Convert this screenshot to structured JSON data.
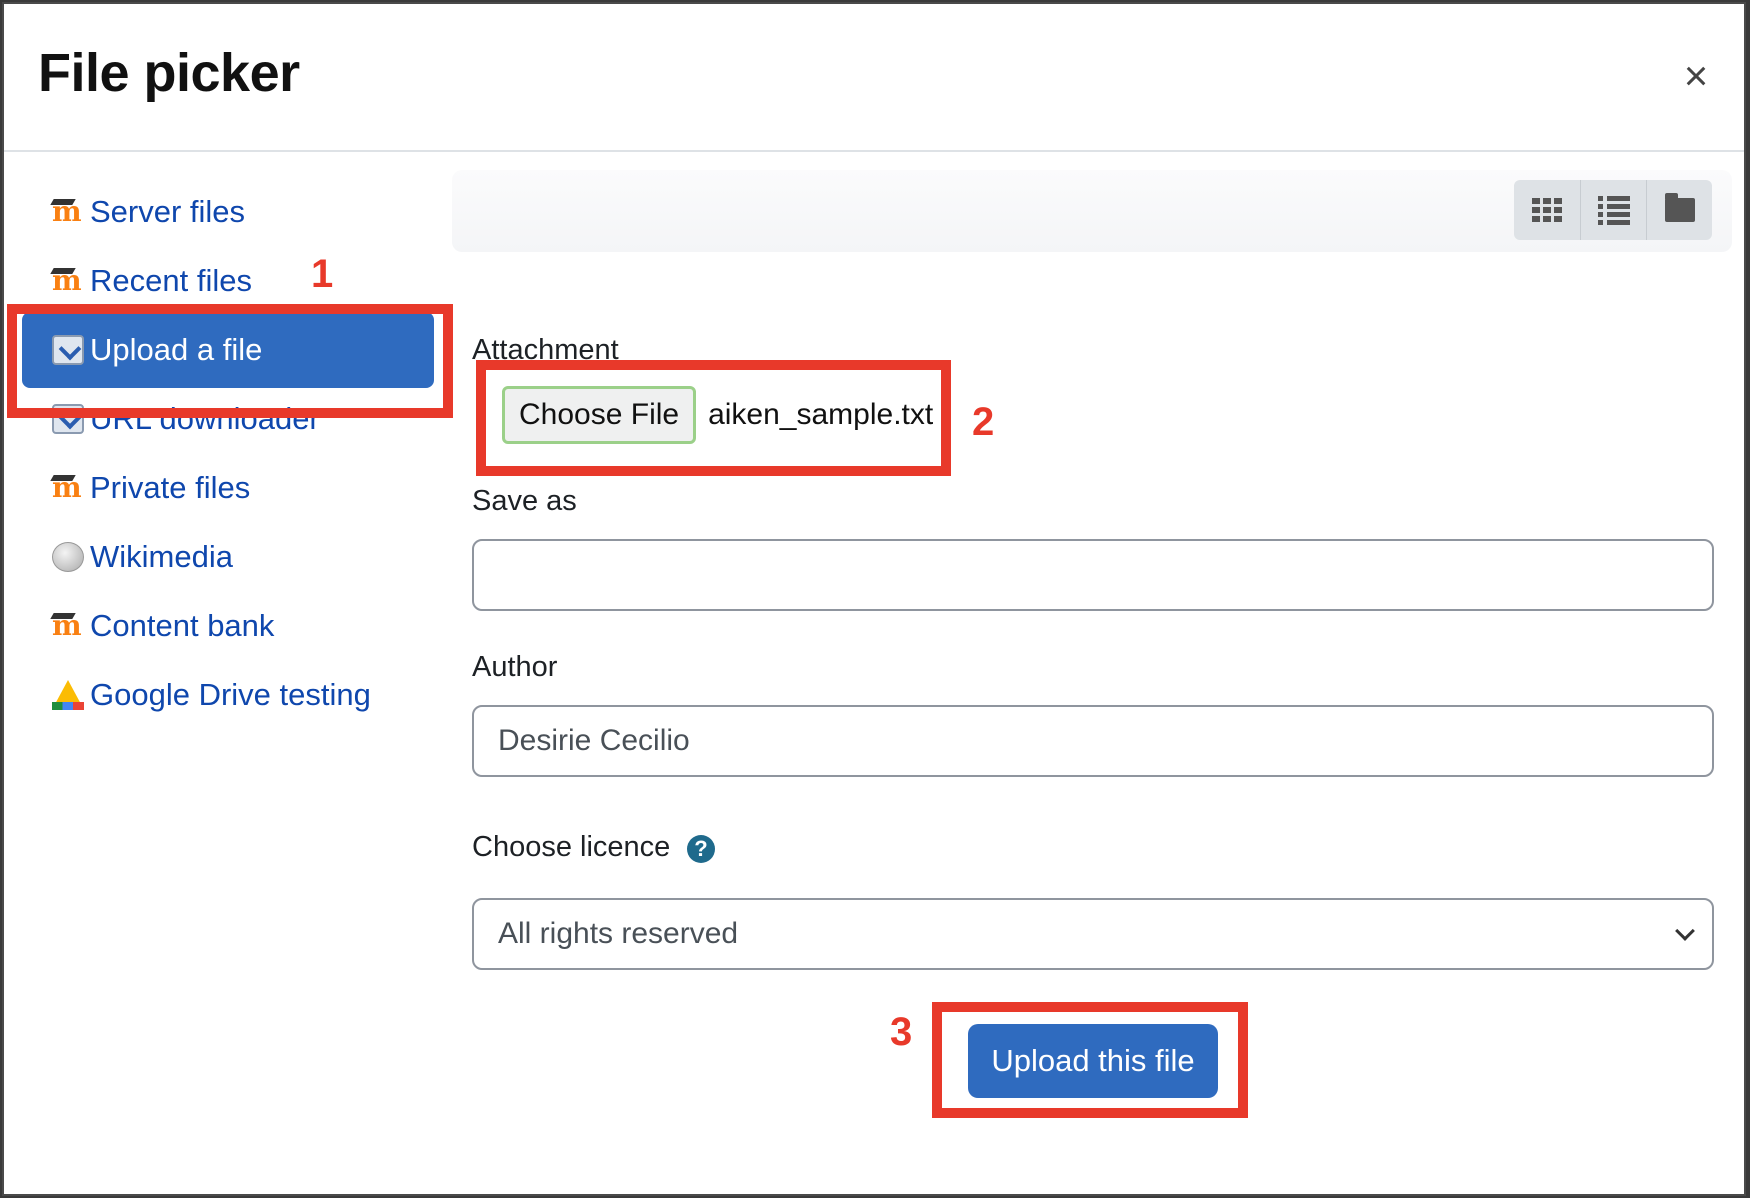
{
  "dialog": {
    "title": "File picker",
    "close_glyph": "×"
  },
  "sidebar": {
    "items": [
      {
        "label": "Server files",
        "icon": "moodle-icon"
      },
      {
        "label": "Recent files",
        "icon": "moodle-icon"
      },
      {
        "label": "Upload a file",
        "icon": "upload-icon",
        "active": true
      },
      {
        "label": "URL downloader",
        "icon": "upload-icon"
      },
      {
        "label": "Private files",
        "icon": "moodle-icon"
      },
      {
        "label": "Wikimedia",
        "icon": "globe-icon"
      },
      {
        "label": "Content bank",
        "icon": "moodle-icon"
      },
      {
        "label": "Google Drive testing",
        "icon": "google-drive-icon"
      }
    ]
  },
  "toolbar": {
    "views": [
      "grid-view-icon",
      "list-view-icon",
      "folder-view-icon"
    ]
  },
  "form": {
    "attachment_label": "Attachment",
    "choose_file_label": "Choose File",
    "file_name": "aiken_sample.txt",
    "save_as_label": "Save as",
    "save_as_value": "",
    "author_label": "Author",
    "author_value": "Desirie Cecilio",
    "licence_label": "Choose licence",
    "licence_value": "All rights reserved",
    "help_glyph": "?",
    "upload_button": "Upload this file"
  },
  "annotations": {
    "step1": "1",
    "step2": "2",
    "step3": "3",
    "color": "#e8392a"
  },
  "colors": {
    "accent": "#2f6bbf",
    "link": "#0f47ad"
  }
}
